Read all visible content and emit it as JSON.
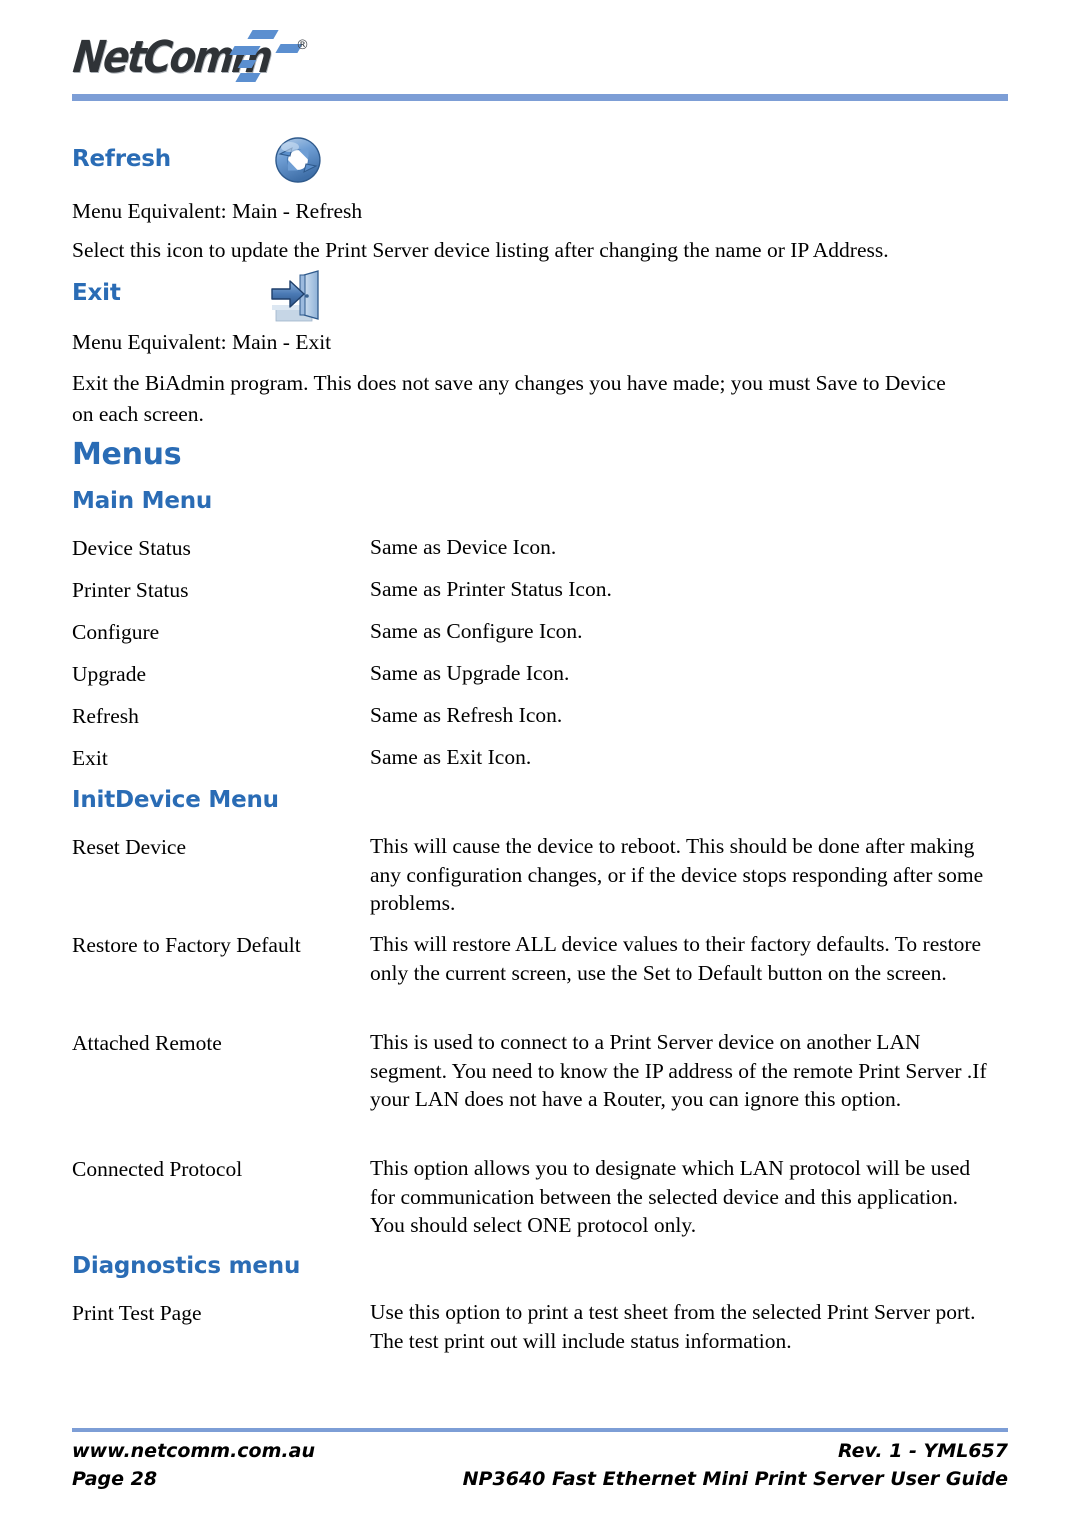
{
  "header": {
    "logo_text": "NetComm",
    "logo_registered": "®"
  },
  "sections": {
    "refresh": {
      "heading": "Refresh",
      "icon": "refresh-circular-arrow-icon",
      "menu_equivalent": "Menu Equivalent: Main - Refresh",
      "description": "Select this icon to update the Print Server device listing after changing the name or IP Address."
    },
    "exit": {
      "heading": "Exit",
      "icon": "exit-door-arrow-icon",
      "menu_equivalent": "Menu Equivalent: Main - Exit",
      "description": "Exit the BiAdmin program. This does not save any changes you have made; you must Save to Device on each screen."
    },
    "menus": {
      "heading": "Menus"
    },
    "main_menu": {
      "heading": "Main Menu",
      "rows": [
        {
          "term": "Device Status",
          "desc": "Same as Device Icon."
        },
        {
          "term": "Printer Status",
          "desc": "Same as Printer Status Icon."
        },
        {
          "term": "Configure",
          "desc": "Same as Configure Icon."
        },
        {
          "term": "Upgrade",
          "desc": "Same as Upgrade Icon."
        },
        {
          "term": "Refresh",
          "desc": "Same as Refresh Icon."
        },
        {
          "term": "Exit",
          "desc": "Same as Exit Icon."
        }
      ]
    },
    "initdevice_menu": {
      "heading": "InitDevice Menu",
      "rows": [
        {
          "term": "Reset Device",
          "desc": "This will cause the device to reboot. This should be done after making any configuration changes, or if the device stops responding after some problems."
        },
        {
          "term": "Restore to Factory Default",
          "desc": "This will restore ALL device values to their factory defaults. To restore only the current screen, use the Set to Default button on the screen."
        },
        {
          "term": "Attached Remote",
          "desc": "This is used to connect to a Print Server device on another LAN segment. You need to know the IP address of the remote Print Server .If your LAN does not have a Router, you can ignore this option."
        },
        {
          "term": "Connected Protocol",
          "desc": "This option allows you to designate which LAN protocol will be used for communication between the selected device and this application. You should select ONE protocol only."
        }
      ]
    },
    "diagnostics_menu": {
      "heading": "Diagnostics menu",
      "rows": [
        {
          "term": "Print Test Page",
          "desc": "Use this option to print a test sheet from the selected Print Server port. The test print out will include status information."
        }
      ]
    }
  },
  "footer": {
    "website": "www.netcomm.com.au",
    "page_number": "Page 28",
    "revision": "Rev. 1 - YML657",
    "guide_title": "NP3640  Fast Ethernet Mini Print Server User Guide"
  },
  "colors": {
    "heading_blue": "#2a6cb5",
    "rule_blue": "#7d9ed6"
  }
}
